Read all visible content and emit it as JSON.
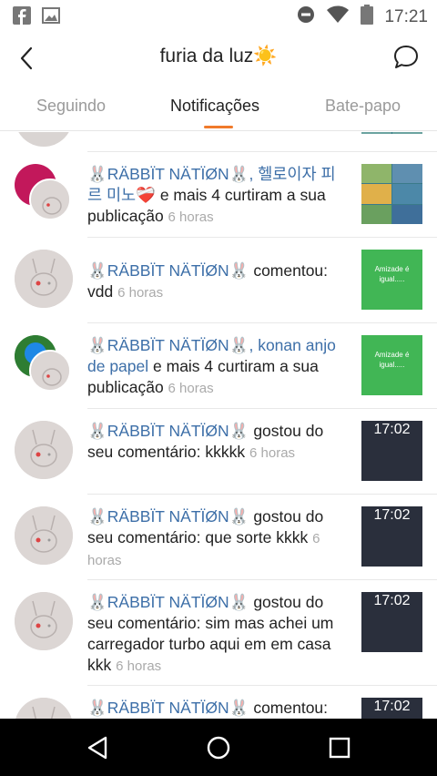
{
  "status_bar": {
    "time": "17:21",
    "icons": [
      "facebook-icon",
      "image-icon",
      "do-not-disturb-icon",
      "wifi-icon",
      "battery-icon"
    ]
  },
  "header": {
    "title": "furia da luz☀️",
    "back_icon": "back-arrow-icon",
    "chat_icon": "chat-bubble-icon"
  },
  "tabs": [
    {
      "label": "Seguindo",
      "active": false
    },
    {
      "label": "Notificações",
      "active": true
    },
    {
      "label": "Bate-papo",
      "active": false
    }
  ],
  "notifications": [
    {
      "user1": "🐰RÄBBÏT NÄTÏØN🐰",
      "sep": ", ",
      "user2": "헬로이자 피르 미노❤️‍🩹",
      "action": " e mais 4 curtiram a sua publicação",
      "time": "6 horas",
      "thumb_type": "grid"
    },
    {
      "user1": "🐰RÄBBÏT NÄTÏØN🐰",
      "action": " comentou: vdd",
      "time": "6 horas",
      "thumb_type": "green",
      "thumb_text": "Amizade é igual....."
    },
    {
      "user1": "🐰RÄBBÏT NÄTÏØN🐰",
      "sep": ", ",
      "user2": "konan anjo de papel",
      "action": " e mais 4 curtiram a sua publicação",
      "time": "6 horas",
      "thumb_type": "green",
      "thumb_text": "Amizade é igual....."
    },
    {
      "user1": "🐰RÄBBÏT NÄTÏØN🐰",
      "action": " gostou do seu comentário: kkkkk",
      "time": "6 horas",
      "thumb_type": "dark",
      "thumb_text": "17:02"
    },
    {
      "user1": "🐰RÄBBÏT NÄTÏØN🐰",
      "action": " gostou do seu comentário: que sorte kkkk",
      "time": "6 horas",
      "thumb_type": "dark",
      "thumb_text": "17:02"
    },
    {
      "user1": "🐰RÄBBÏT NÄTÏØN🐰",
      "action": " gostou do seu comentário: sim mas achei um carregador turbo aqui em em casa kkk",
      "time": "6 horas",
      "thumb_type": "dark",
      "thumb_text": "17:02"
    },
    {
      "user1": "🐰RÄBBÏT NÄTÏØN🐰",
      "action": " comentou:",
      "time": "",
      "thumb_type": "dark",
      "thumb_text": "17:02"
    }
  ],
  "nav_bar": {
    "icons": [
      "back-triangle-icon",
      "home-circle-icon",
      "recents-square-icon"
    ]
  },
  "colors": {
    "accent": "#f07a2b",
    "username": "#3d6fa8",
    "time": "#aaaaaa",
    "green_thumb": "#41b655"
  }
}
